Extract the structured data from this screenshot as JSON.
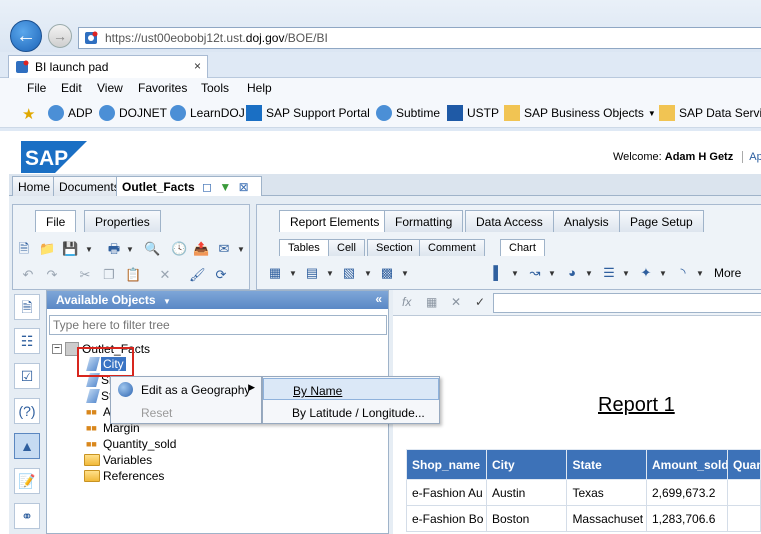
{
  "browser": {
    "url_prefix": "https://ust00eobobj12t.ust.",
    "url_domain": "doj.gov",
    "url_path": "/BOE/BI",
    "tab_title": "BI launch pad",
    "tab_close": "×",
    "menu": [
      "File",
      "Edit",
      "View",
      "Favorites",
      "Tools",
      "Help"
    ],
    "favorites": [
      "ADP",
      "DOJNET",
      "LearnDOJ",
      "SAP Support Portal",
      "Subtime",
      "USTP",
      "SAP Business Objects",
      "SAP Data Servic"
    ]
  },
  "sap": {
    "welcome_label": "Welcome:",
    "user_name": "Adam H Getz",
    "app_link": "App",
    "doc_tabs": [
      "Home",
      "Documents",
      "Outlet_Facts"
    ]
  },
  "ribbon": {
    "left_tabs": [
      "File",
      "Properties"
    ],
    "right_tabs": [
      "Report Elements",
      "Formatting",
      "Data Access",
      "Analysis",
      "Page Setup"
    ],
    "sub_tabs": [
      "Tables",
      "Cell",
      "Section",
      "Comment"
    ],
    "chart_tab": "Chart",
    "more_label": "More"
  },
  "objects": {
    "title": "Available Objects",
    "collapse": "«",
    "filter_placeholder": "Type here to filter tree",
    "root": "Outlet_Facts",
    "items": [
      "City",
      "Sh",
      "St",
      "Am",
      "Margin",
      "Quantity_sold",
      "Variables",
      "References"
    ]
  },
  "context_menu": {
    "item1": "Edit as a Geography",
    "item2": "Reset",
    "submenu": [
      "By Name",
      "By Latitude / Longitude..."
    ]
  },
  "report": {
    "title": "Report 1",
    "columns": [
      "Shop_name",
      "City",
      "State",
      "Amount_sold",
      "Quan"
    ],
    "rows": [
      [
        "e-Fashion Au",
        "Austin",
        "Texas",
        "2,699,673.2",
        ""
      ],
      [
        "e-Fashion Bo",
        "Boston",
        "Massachuset",
        "1,283,706.6",
        ""
      ]
    ]
  },
  "colors": {
    "header_blue": "#3d72b8",
    "panel_head": "#5a88c6",
    "highlight_red": "#d7261e"
  }
}
